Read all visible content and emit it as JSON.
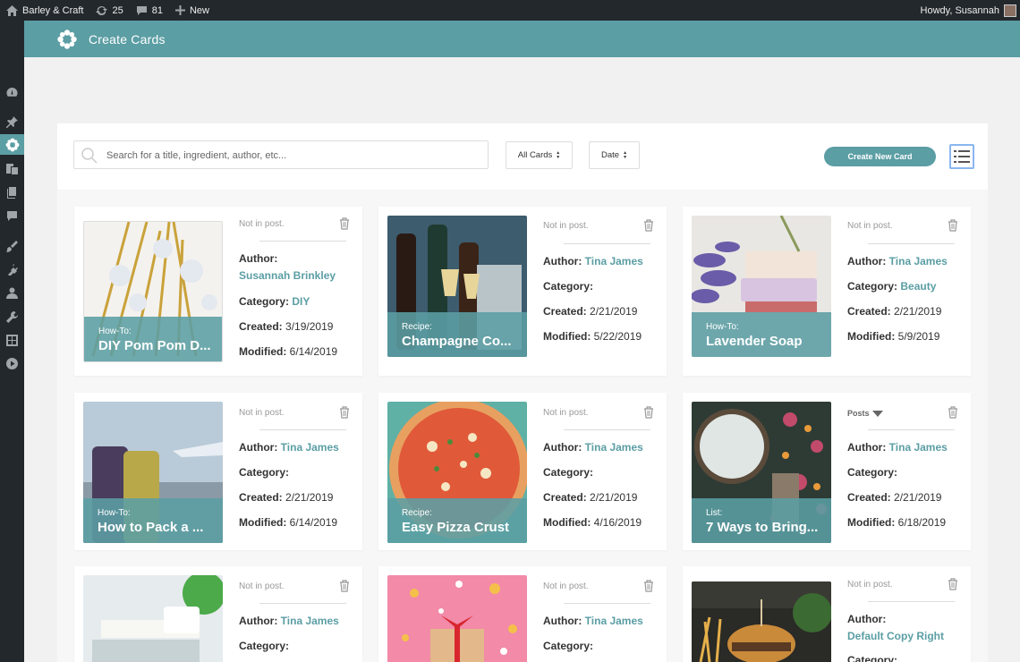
{
  "admin_bar": {
    "site_name": "Barley & Craft",
    "updates_count": "25",
    "comments_count": "81",
    "new_label": "New",
    "greeting": "Howdy, Susannah"
  },
  "admin_menu": {
    "icons": [
      "dashboard-icon",
      "pin-icon",
      "create-cards-icon",
      "media-icon",
      "pages-icon",
      "comments-icon",
      "appearance-icon",
      "plugins-icon",
      "users-icon",
      "tools-icon",
      "settings-icon",
      "play-icon"
    ]
  },
  "header": {
    "title": "Create Cards"
  },
  "toolbar": {
    "search_placeholder": "Search for a title, ingredient, author, etc...",
    "filter_label": "All Cards",
    "sort_label": "Date",
    "create_button": "Create New Card"
  },
  "labels": {
    "author": "Author:",
    "category": "Category:",
    "created": "Created:",
    "modified": "Modified:"
  },
  "cards": [
    {
      "type": "How-To:",
      "title": "DIY Pom Pom D...",
      "status": "Not in post.",
      "author": "Susannah Brinkley",
      "category": "DIY",
      "created": "3/19/2019",
      "modified": "6/14/2019"
    },
    {
      "type": "Recipe:",
      "title": "Champagne Co...",
      "status": "Not in post.",
      "author": "Tina James",
      "category": "",
      "created": "2/21/2019",
      "modified": "5/22/2019"
    },
    {
      "type": "How-To:",
      "title": "Lavender Soap",
      "status": "Not in post.",
      "author": "Tina James",
      "category": "Beauty",
      "created": "2/21/2019",
      "modified": "5/9/2019"
    },
    {
      "type": "How-To:",
      "title": "How to Pack a ...",
      "status": "Not in post.",
      "author": "Tina James",
      "category": "",
      "created": "2/21/2019",
      "modified": "6/14/2019"
    },
    {
      "type": "Recipe:",
      "title": "Easy Pizza Crust",
      "status": "Not in post.",
      "author": "Tina James",
      "category": "",
      "created": "2/21/2019",
      "modified": "4/16/2019"
    },
    {
      "type": "List:",
      "title": "7 Ways to Bring...",
      "status": "Posts",
      "author": "Tina James",
      "category": "",
      "created": "2/21/2019",
      "modified": "6/18/2019"
    },
    {
      "status": "Not in post.",
      "author": "Tina James",
      "category": ""
    },
    {
      "status": "Not in post.",
      "author": "Tina James",
      "category": ""
    },
    {
      "status": "Not in post.",
      "author": "Default Copy Right",
      "category": ""
    }
  ],
  "colors": {
    "accent": "#5b9ea4",
    "admin_dark": "#23282d"
  }
}
